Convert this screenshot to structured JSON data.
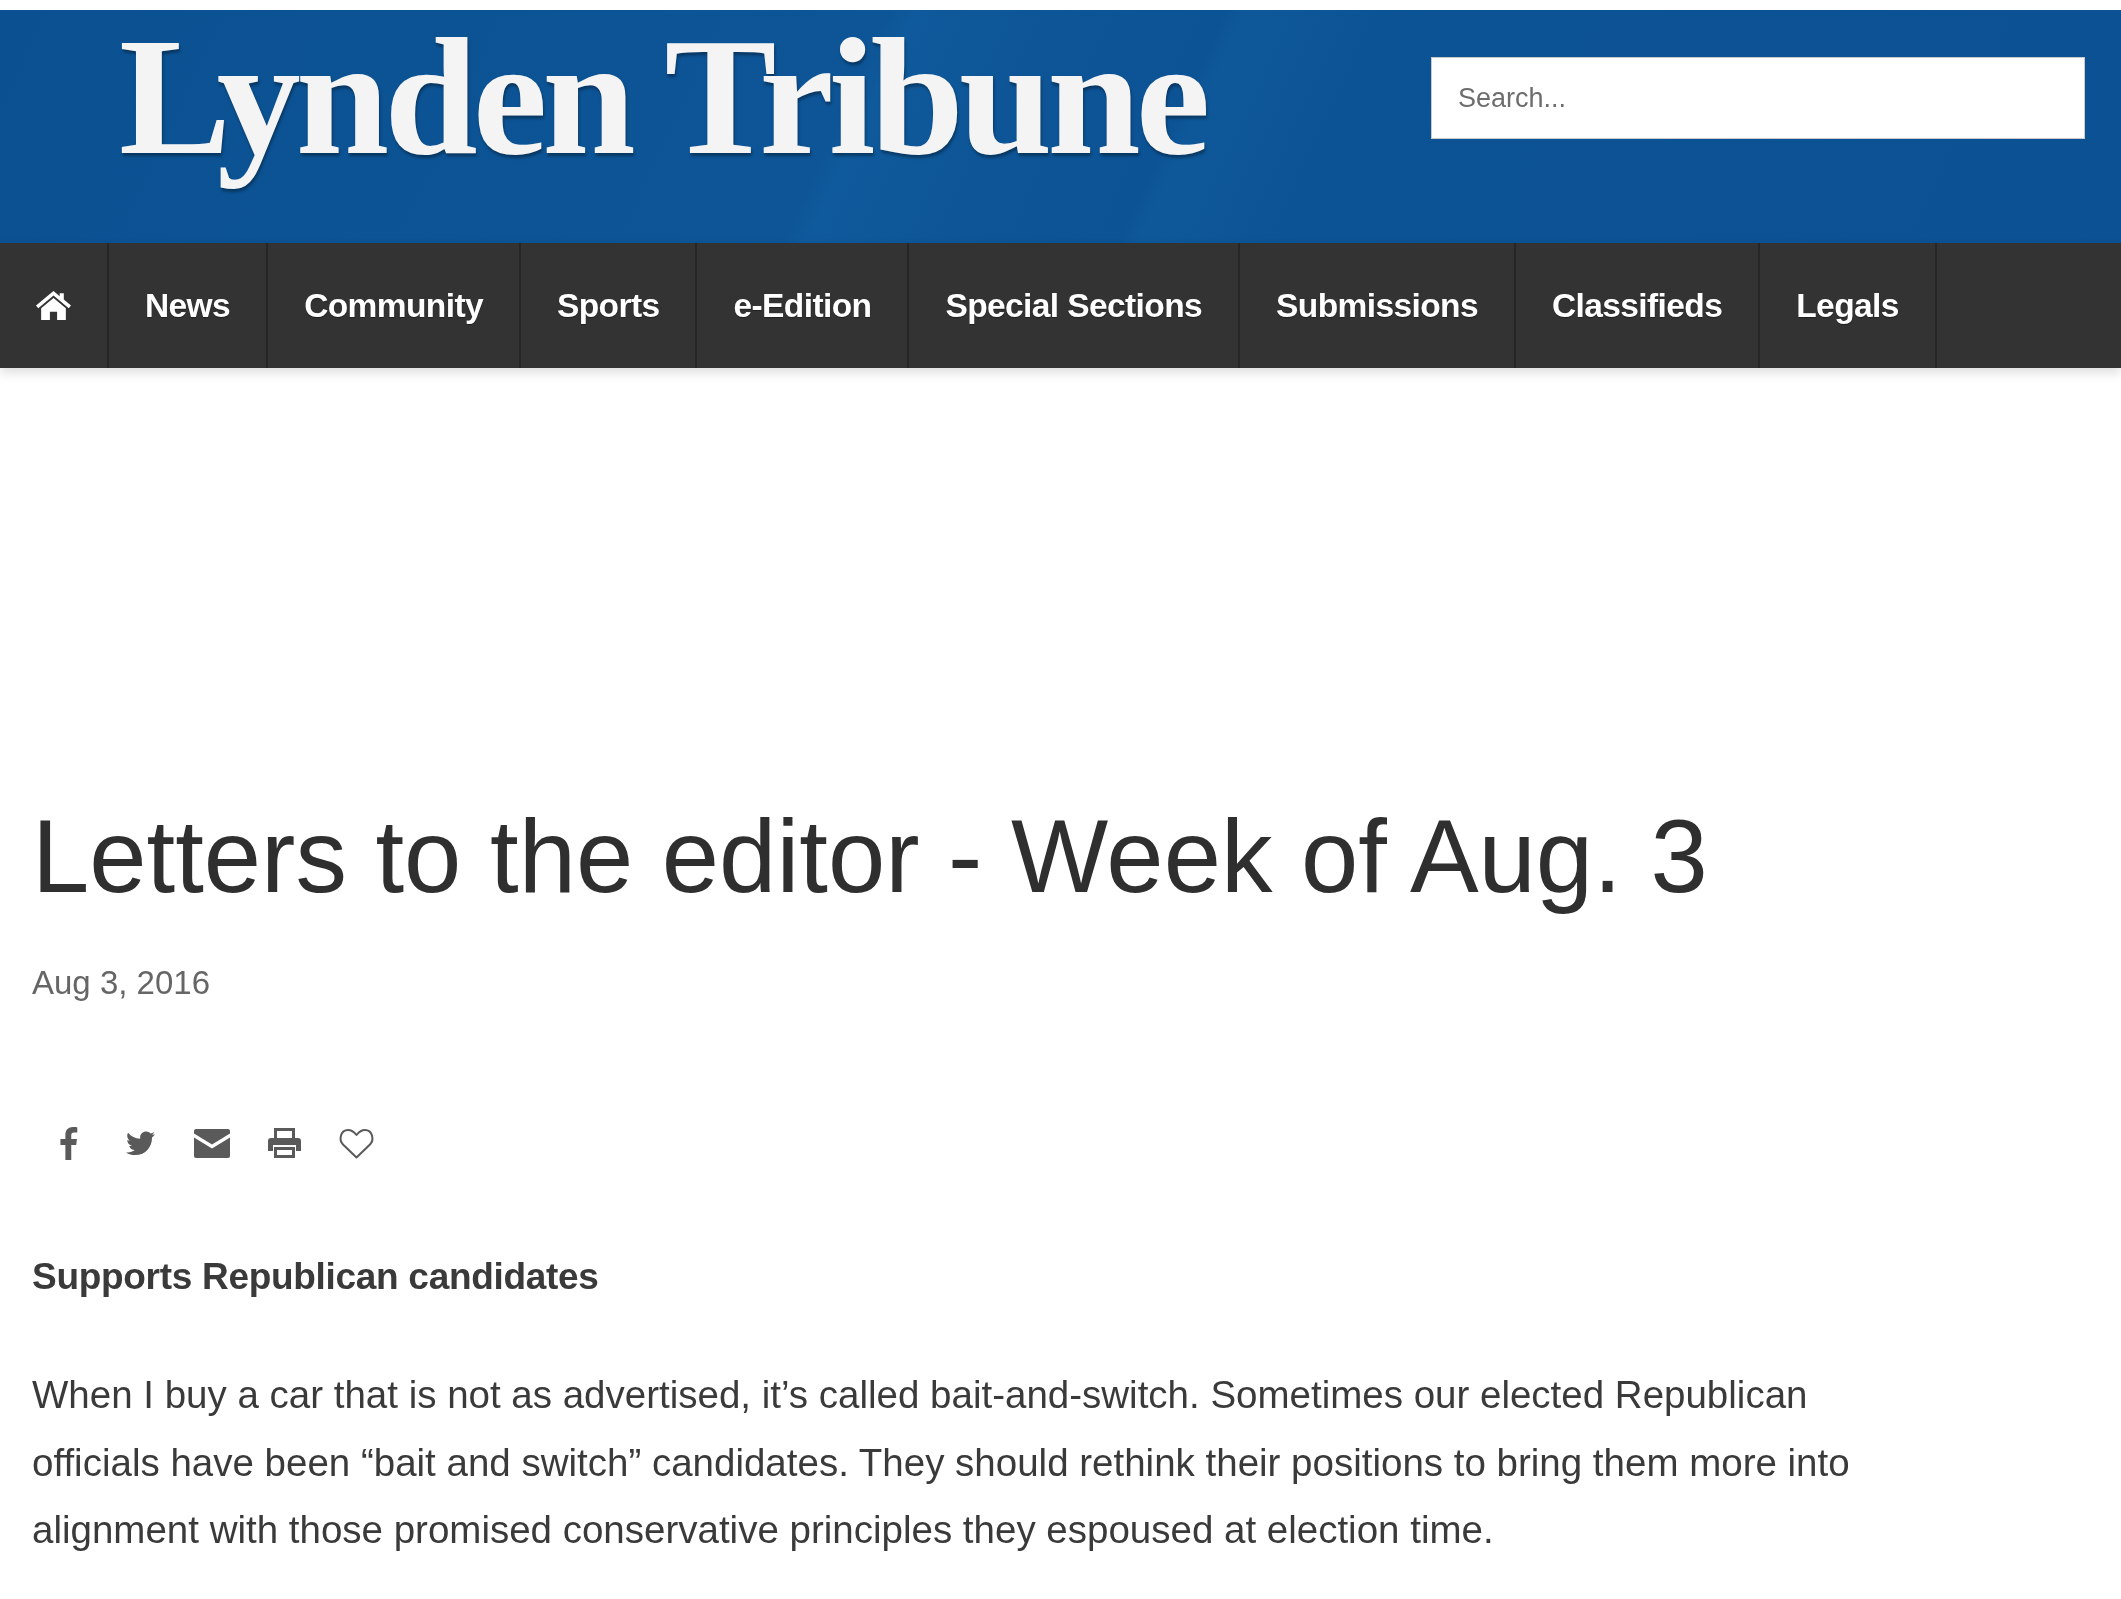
{
  "header": {
    "logo": "Lynden Tribune",
    "search": {
      "placeholder": "Search..."
    }
  },
  "nav": {
    "items": [
      {
        "kind": "home"
      },
      {
        "kind": "link",
        "label": "News"
      },
      {
        "kind": "link",
        "label": "Community"
      },
      {
        "kind": "link",
        "label": "Sports"
      },
      {
        "kind": "link",
        "label": "e-Edition"
      },
      {
        "kind": "link",
        "label": "Special Sections"
      },
      {
        "kind": "link",
        "label": "Submissions"
      },
      {
        "kind": "link",
        "label": "Classifieds"
      },
      {
        "kind": "link",
        "label": "Legals"
      }
    ]
  },
  "article": {
    "title": "Letters to the editor - Week of Aug. 3",
    "date": "Aug 3, 2016",
    "subheading": "Supports Republican candidates",
    "paragraphs": [
      "When I buy a car that is not as advertised, it’s called bait-and-switch. Sometimes our elected Republican officials have been “bait and switch” candidates. They should rethink their positions to bring them more into alignment with those promised conservative principles they espoused at election time."
    ]
  }
}
